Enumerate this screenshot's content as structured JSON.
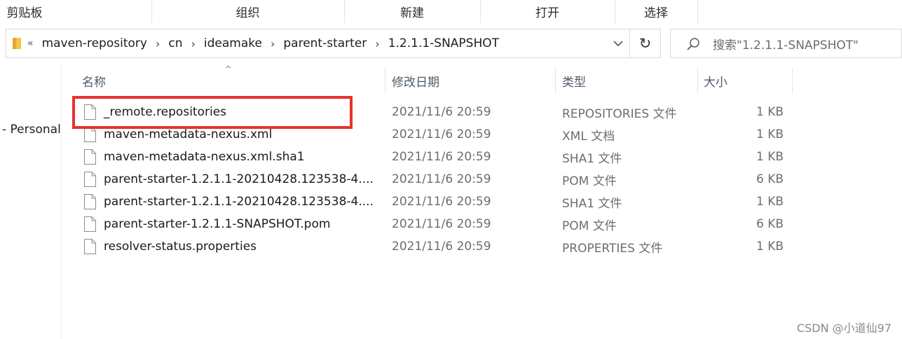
{
  "ribbon": {
    "groups": [
      "剪贴板",
      "组织",
      "新建",
      "打开",
      "选择"
    ]
  },
  "address": {
    "overflow": "«",
    "crumbs": [
      "maven-repository",
      "cn",
      "ideamake",
      "parent-starter",
      "1.2.1.1-SNAPSHOT"
    ]
  },
  "search": {
    "placeholder": "搜索\"1.2.1.1-SNAPSHOT\""
  },
  "nav": {
    "item": "- Personal"
  },
  "columns": {
    "name": "名称",
    "date": "修改日期",
    "type": "类型",
    "size": "大小"
  },
  "files": [
    {
      "name": "_remote.repositories",
      "date": "2021/11/6 20:59",
      "type": "REPOSITORIES 文件",
      "size": "1 KB"
    },
    {
      "name": "maven-metadata-nexus.xml",
      "date": "2021/11/6 20:59",
      "type": "XML 文档",
      "size": "1 KB"
    },
    {
      "name": "maven-metadata-nexus.xml.sha1",
      "date": "2021/11/6 20:59",
      "type": "SHA1 文件",
      "size": "1 KB"
    },
    {
      "name": "parent-starter-1.2.1.1-20210428.123538-4....",
      "date": "2021/11/6 20:59",
      "type": "POM 文件",
      "size": "6 KB"
    },
    {
      "name": "parent-starter-1.2.1.1-20210428.123538-4....",
      "date": "2021/11/6 20:59",
      "type": "SHA1 文件",
      "size": "1 KB"
    },
    {
      "name": "parent-starter-1.2.1.1-SNAPSHOT.pom",
      "date": "2021/11/6 20:59",
      "type": "POM 文件",
      "size": "6 KB"
    },
    {
      "name": "resolver-status.properties",
      "date": "2021/11/6 20:59",
      "type": "PROPERTIES 文件",
      "size": "1 KB"
    }
  ],
  "watermark": "CSDN @小道仙97",
  "colors": {
    "highlight": "#e8312f",
    "header_text": "#4d5a6b",
    "folder": "#f4c542"
  },
  "icons": [
    "folder-icon",
    "chevron-right-icon",
    "chevron-down-icon",
    "refresh-icon",
    "search-icon",
    "file-icon",
    "sort-up-icon"
  ]
}
